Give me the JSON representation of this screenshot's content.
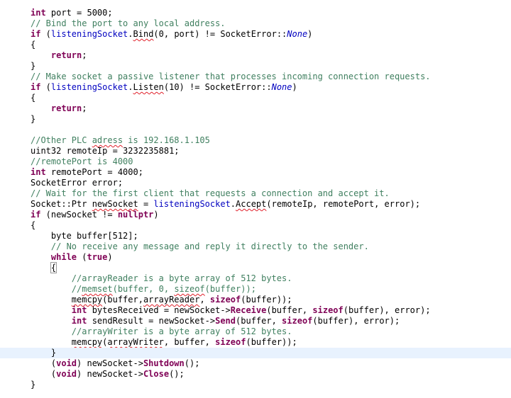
{
  "editor": {
    "lines": [
      [
        {
          "t": "int",
          "c": "kw"
        },
        {
          "t": " port = 5000;"
        }
      ],
      [
        {
          "t": "// Bind the port to any local address.",
          "c": "cm"
        }
      ],
      [
        {
          "t": "if",
          "c": "kw"
        },
        {
          "t": " ("
        },
        {
          "t": "listeningSocket",
          "c": "fld"
        },
        {
          "t": "."
        },
        {
          "t": "Bind",
          "c": "sq"
        },
        {
          "t": "(0, port) != SocketError::"
        },
        {
          "t": "None",
          "c": "it"
        },
        {
          "t": ")"
        }
      ],
      [
        {
          "t": "{"
        }
      ],
      [
        {
          "t": "    "
        },
        {
          "t": "return",
          "c": "kw"
        },
        {
          "t": ";"
        }
      ],
      [
        {
          "t": "}"
        }
      ],
      [
        {
          "t": "// Make socket a passive listener that processes incoming connection requests.",
          "c": "cm"
        }
      ],
      [
        {
          "t": "if",
          "c": "kw"
        },
        {
          "t": " ("
        },
        {
          "t": "listeningSocket",
          "c": "fld"
        },
        {
          "t": "."
        },
        {
          "t": "Listen",
          "c": "sq"
        },
        {
          "t": "(10) != SocketError::"
        },
        {
          "t": "None",
          "c": "it"
        },
        {
          "t": ")"
        }
      ],
      [
        {
          "t": "{"
        }
      ],
      [
        {
          "t": "    "
        },
        {
          "t": "return",
          "c": "kw"
        },
        {
          "t": ";"
        }
      ],
      [
        {
          "t": "}"
        }
      ],
      [],
      [
        {
          "t": "//Other PLC ",
          "c": "cm"
        },
        {
          "t": "adress",
          "c": "cm sq"
        },
        {
          "t": " is 192.168.1.105",
          "c": "cm"
        }
      ],
      [
        {
          "t": "uint32 remoteIp = 3232235881;"
        }
      ],
      [
        {
          "t": "//remotePort is 4000",
          "c": "cm"
        }
      ],
      [
        {
          "t": "int",
          "c": "kw"
        },
        {
          "t": " remotePort = 4000;"
        }
      ],
      [
        {
          "t": "SocketError error;"
        }
      ],
      [
        {
          "t": "// Wait for the first client that requests a connection and accept it.",
          "c": "cm"
        }
      ],
      [
        {
          "t": "Socket::Ptr "
        },
        {
          "t": "newSocket",
          "c": "sq"
        },
        {
          "t": " = "
        },
        {
          "t": "listeningSocket",
          "c": "fld"
        },
        {
          "t": "."
        },
        {
          "t": "Accept",
          "c": "sq"
        },
        {
          "t": "(remoteIp, remotePort, error);"
        }
      ],
      [
        {
          "t": "if",
          "c": "kw"
        },
        {
          "t": " (newSocket != "
        },
        {
          "t": "nullptr",
          "c": "kw"
        },
        {
          "t": ")"
        }
      ],
      [
        {
          "t": "{"
        }
      ],
      [
        {
          "t": "    byte buffer[512];"
        }
      ],
      [
        {
          "t": "    "
        },
        {
          "t": "// No receive any message and reply it directly to the sender.",
          "c": "cm"
        }
      ],
      [
        {
          "t": "    "
        },
        {
          "t": "while",
          "c": "kw"
        },
        {
          "t": " ("
        },
        {
          "t": "true",
          "c": "kw"
        },
        {
          "t": ")"
        }
      ],
      [
        {
          "t": "    "
        },
        {
          "t": "{",
          "c": "bracket-box"
        }
      ],
      [
        {
          "t": "        "
        },
        {
          "t": "//arrayReader is a byte array of 512 bytes.",
          "c": "cm"
        }
      ],
      [
        {
          "t": "        "
        },
        {
          "t": "//",
          "c": "cm"
        },
        {
          "t": "memset",
          "c": "cm sq"
        },
        {
          "t": "(buffer, 0, ",
          "c": "cm"
        },
        {
          "t": "sizeof",
          "c": "cm sq"
        },
        {
          "t": "(buffer));",
          "c": "cm"
        }
      ],
      [
        {
          "t": "        "
        },
        {
          "t": "memcpy",
          "c": "sq"
        },
        {
          "t": "(buffer,"
        },
        {
          "t": "arrayReader",
          "c": "sq"
        },
        {
          "t": ", "
        },
        {
          "t": "sizeof",
          "c": "kw"
        },
        {
          "t": "(buffer));"
        }
      ],
      [
        {
          "t": "        "
        },
        {
          "t": "int",
          "c": "kw"
        },
        {
          "t": " bytesReceived = newSocket->"
        },
        {
          "t": "Receive",
          "c": "kw"
        },
        {
          "t": "(buffer, "
        },
        {
          "t": "sizeof",
          "c": "kw"
        },
        {
          "t": "(buffer), error);"
        }
      ],
      [
        {
          "t": "        "
        },
        {
          "t": "int",
          "c": "kw"
        },
        {
          "t": " sendResult = newSocket->"
        },
        {
          "t": "Send",
          "c": "kw"
        },
        {
          "t": "(buffer, "
        },
        {
          "t": "sizeof",
          "c": "kw"
        },
        {
          "t": "(buffer), error);"
        }
      ],
      [
        {
          "t": "        "
        },
        {
          "t": "//arrayWriter is a byte array of 512 bytes.",
          "c": "cm"
        }
      ],
      [
        {
          "t": "        "
        },
        {
          "t": "memcpy",
          "c": "sq"
        },
        {
          "t": "("
        },
        {
          "t": "arrayWriter",
          "c": "sq"
        },
        {
          "t": ", buffer, "
        },
        {
          "t": "sizeof",
          "c": "kw"
        },
        {
          "t": "(buffer));"
        }
      ],
      [
        {
          "t": "    }"
        }
      ],
      [
        {
          "t": "    ("
        },
        {
          "t": "void",
          "c": "kw"
        },
        {
          "t": ") newSocket->"
        },
        {
          "t": "Shutdown",
          "c": "kw"
        },
        {
          "t": "();"
        }
      ],
      [
        {
          "t": "    ("
        },
        {
          "t": "void",
          "c": "kw"
        },
        {
          "t": ") newSocket->"
        },
        {
          "t": "Close",
          "c": "kw"
        },
        {
          "t": "();"
        }
      ],
      [
        {
          "t": "}"
        }
      ]
    ],
    "current_line_index": 32
  }
}
